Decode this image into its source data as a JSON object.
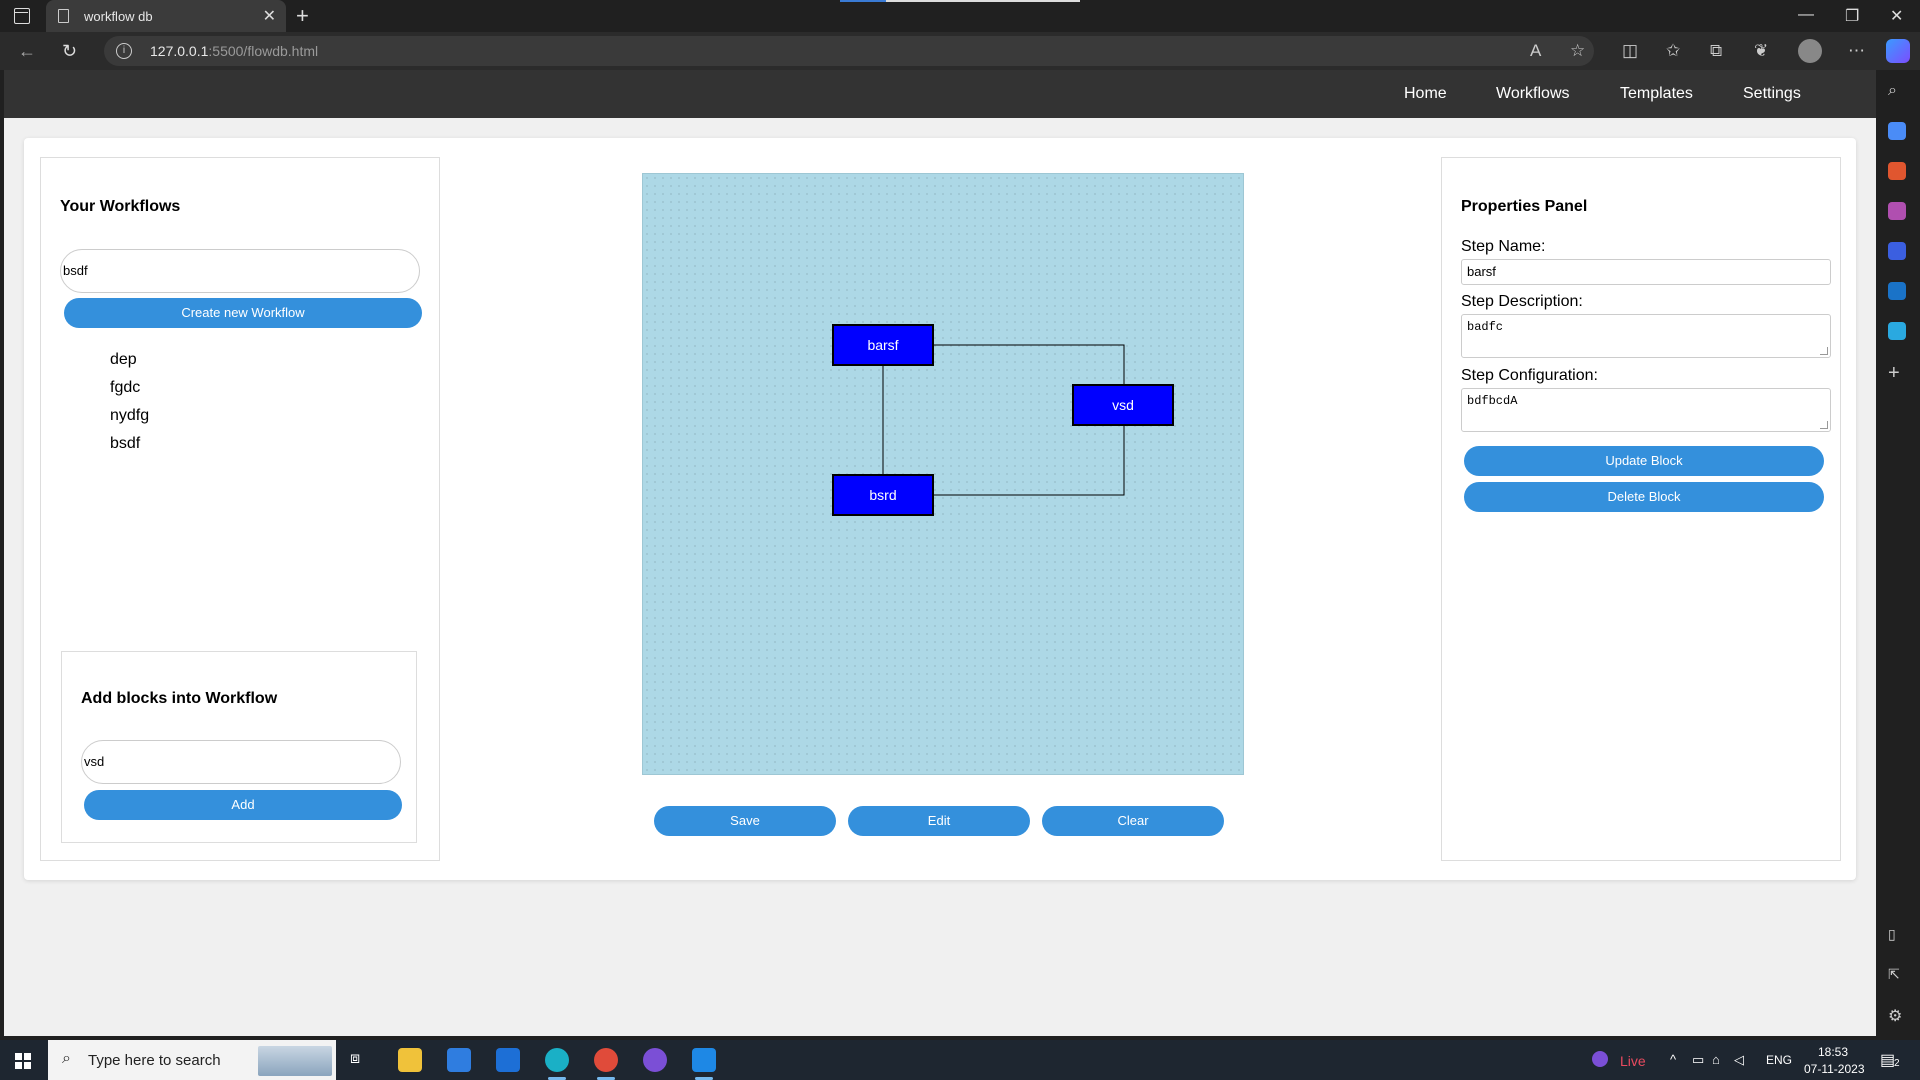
{
  "browser": {
    "tab_title": "workflow db",
    "url_host": "127.0.0.1",
    "url_rest": ":5500/flowdb.html"
  },
  "nav": {
    "links": [
      "Home",
      "Workflows",
      "Templates",
      "Settings"
    ]
  },
  "left_panel": {
    "title": "Your Workflows",
    "workflow_input_value": "bsdf",
    "create_button": "Create new Workflow",
    "workflows": [
      "dep",
      "fgdc",
      "nydfg",
      "bsdf"
    ],
    "add_blocks": {
      "title": "Add blocks into Workflow",
      "input_value": "vsd",
      "add_button": "Add"
    }
  },
  "canvas": {
    "background_color": "#add8e6",
    "block_color": "#0000ff",
    "blocks": [
      "barsf",
      "vsd",
      "bsrd"
    ],
    "buttons": [
      "Save",
      "Edit",
      "Clear"
    ]
  },
  "properties": {
    "title": "Properties Panel",
    "step_name_label": "Step Name:",
    "step_name_value": "barsf",
    "step_description_label": "Step Description:",
    "step_description_value": "badfc",
    "step_configuration_label": "Step Configuration:",
    "step_configuration_value": "bdfbcdA",
    "update_button": "Update Block",
    "delete_button": "Delete Block"
  },
  "taskbar": {
    "search_placeholder": "Type here to search",
    "live_label": "Live",
    "language": "ENG",
    "time": "18:53",
    "date": "07-11-2023",
    "notification_count": "2"
  },
  "colors": {
    "accent": "#3490dc",
    "navbar": "#333333"
  }
}
